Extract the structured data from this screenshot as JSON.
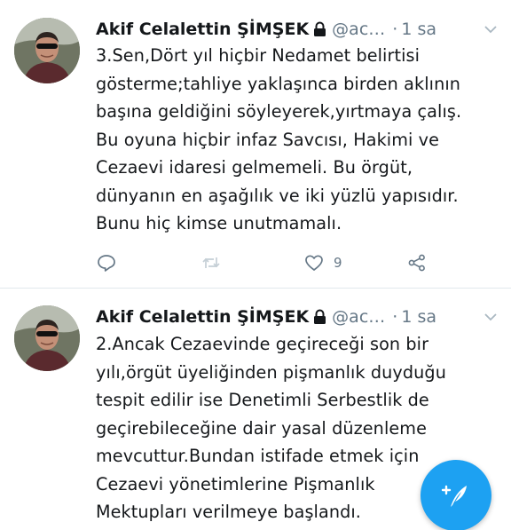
{
  "tweets": [
    {
      "author_name": "Akif Celalettin ŞİMŞEK",
      "handle": "@ac…",
      "separator": "·",
      "time": "1 sa",
      "text": "3.Sen,Dört yıl hiçbir Nedamet belirtisi\ngösterme;tahliye yaklaşınca birden aklının\nbaşına geldiğini söyleyerek,yırtmaya çalış.\nBu oyuna hiçbir infaz Savcısı, Hakimi ve\nCezaevi idaresi gelmemeli. Bu örgüt,\ndünyanın en aşağılık ve iki yüzlü yapısıdır.\nBunu hiç kimse unutmamalı.",
      "like_count": "9"
    },
    {
      "author_name": "Akif Celalettin ŞİMŞEK",
      "handle": "@ac…",
      "separator": "·",
      "time": "1 sa",
      "text": "2.Ancak Cezaevinde geçireceği son bir\nyılı,örgüt üyeliğinden pişmanlık duyduğu\ntespit edilir ise Denetimli Serbestlik de\ngeçirebileceğine dair yasal düzenleme\nmevcuttur.Bundan istifade etmek için\nCezaevi yönetimlerine Pişmanlık\nMektupları verilmeye başlandı."
    }
  ],
  "icons": {
    "protected": "lock-icon",
    "menu": "chevron-down-icon",
    "reply": "reply-icon",
    "retweet": "retweet-icon",
    "like": "heart-icon",
    "share": "share-icon",
    "compose": "compose-feather-icon"
  },
  "colors": {
    "accent": "#1da1f2",
    "secondary_text": "#657786",
    "primary_text": "#14171a",
    "divider": "#e1e8ed"
  }
}
